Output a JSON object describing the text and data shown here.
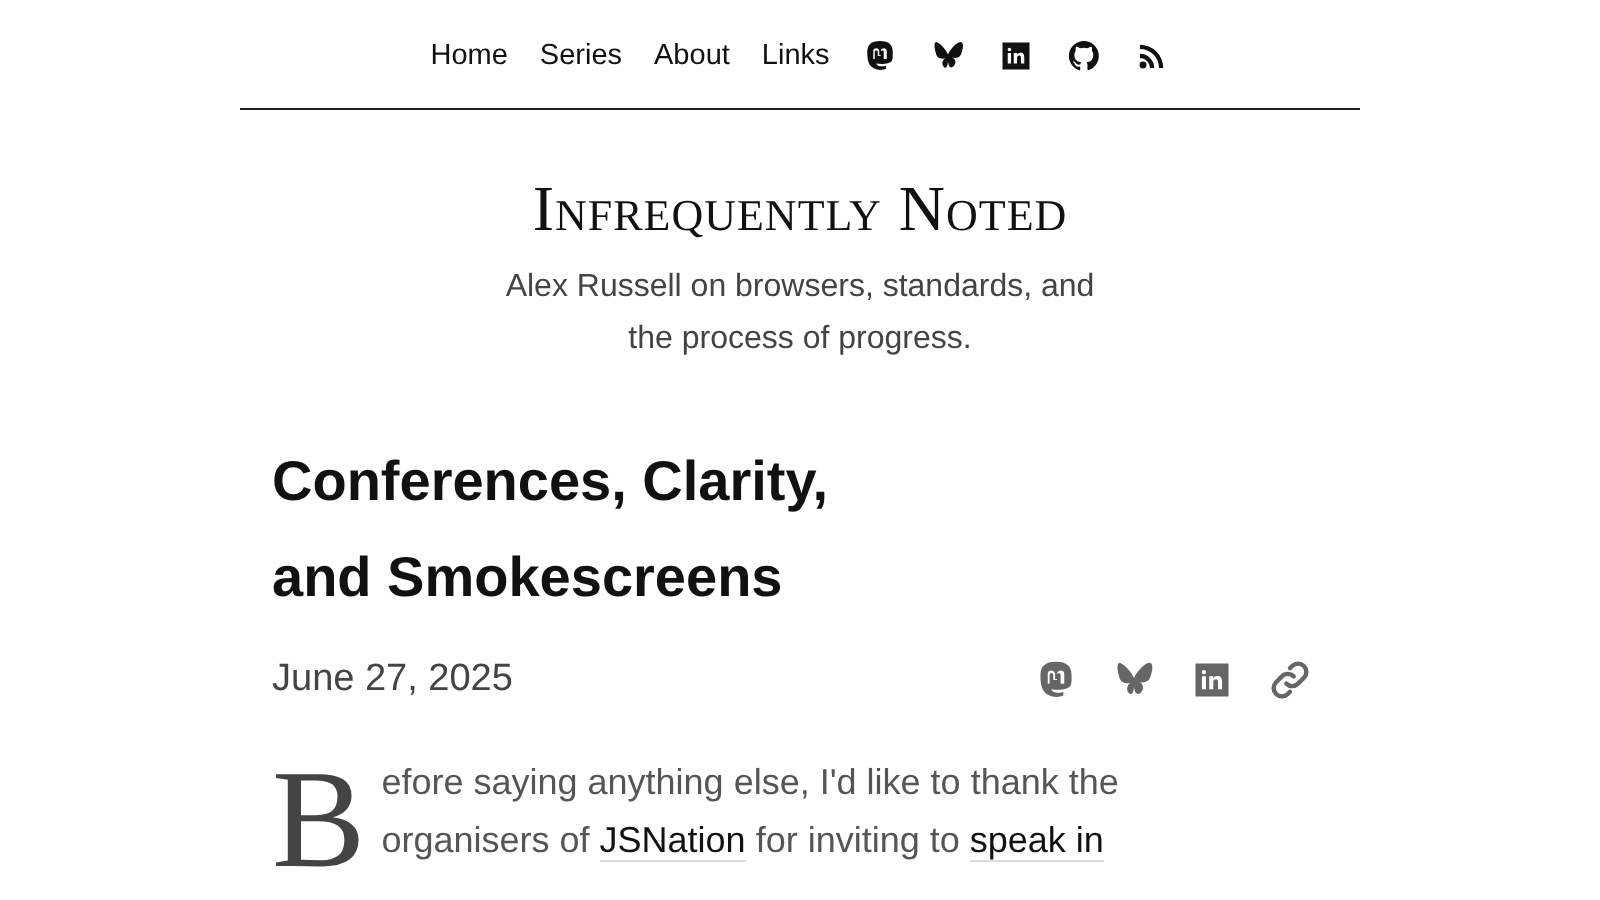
{
  "nav": {
    "links": [
      "Home",
      "Series",
      "About",
      "Links"
    ],
    "icons": [
      {
        "kind": "mastodon"
      },
      {
        "kind": "bluesky"
      },
      {
        "kind": "linkedin"
      },
      {
        "kind": "github"
      },
      {
        "kind": "rss"
      }
    ]
  },
  "site": {
    "title": "Infrequently Noted",
    "tagline": "Alex Russell on browsers, standards, and the process of progress."
  },
  "post": {
    "title": "Conferences, Clarity, and Smokescreens",
    "date": "June 27, 2025",
    "share": [
      {
        "kind": "mastodon"
      },
      {
        "kind": "bluesky"
      },
      {
        "kind": "linkedin"
      },
      {
        "kind": "link"
      }
    ],
    "drop_cap": "B",
    "segments": [
      {
        "kind": "text",
        "text": "efore saying anything else, I'd like to thank the organisers of "
      },
      {
        "kind": "link",
        "text": "JSNation"
      },
      {
        "kind": "text",
        "text": " for inviting to "
      },
      {
        "kind": "link",
        "text": "speak in"
      }
    ]
  }
}
